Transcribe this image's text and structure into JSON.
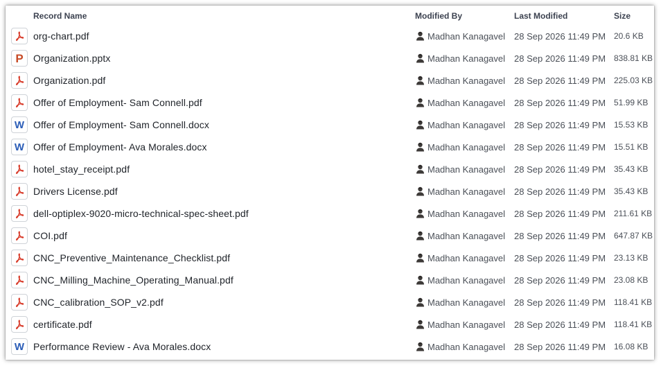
{
  "columns": {
    "record_name": "Record Name",
    "modified_by": "Modified By",
    "last_modified": "Last Modified",
    "size": "Size"
  },
  "colors": {
    "pdf_icon": "#d83b2a",
    "word_icon": "#2b5db7",
    "ppt_icon": "#c74b27"
  },
  "rows": [
    {
      "name": "org-chart.pdf",
      "type": "pdf",
      "modified_by": "Madhan Kanagavel",
      "last_modified": "28 Sep 2026 11:49 PM",
      "size": "20.6 KB"
    },
    {
      "name": "Organization.pptx",
      "type": "pptx",
      "icon_letter": "P",
      "modified_by": "Madhan Kanagavel",
      "last_modified": "28 Sep 2026 11:49 PM",
      "size": "838.81 KB"
    },
    {
      "name": "Organization.pdf",
      "type": "pdf",
      "modified_by": "Madhan Kanagavel",
      "last_modified": "28 Sep 2026 11:49 PM",
      "size": "225.03 KB"
    },
    {
      "name": "Offer of Employment- Sam Connell.pdf",
      "type": "pdf",
      "modified_by": "Madhan Kanagavel",
      "last_modified": "28 Sep 2026 11:49 PM",
      "size": "51.99 KB"
    },
    {
      "name": "Offer of Employment- Sam Connell.docx",
      "type": "docx",
      "icon_letter": "W",
      "modified_by": "Madhan Kanagavel",
      "last_modified": "28 Sep 2026 11:49 PM",
      "size": "15.53 KB"
    },
    {
      "name": "Offer of Employment- Ava Morales.docx",
      "type": "docx",
      "icon_letter": "W",
      "modified_by": "Madhan Kanagavel",
      "last_modified": "28 Sep 2026 11:49 PM",
      "size": "15.51 KB"
    },
    {
      "name": "hotel_stay_receipt.pdf",
      "type": "pdf",
      "modified_by": "Madhan Kanagavel",
      "last_modified": "28 Sep 2026 11:49 PM",
      "size": "35.43 KB"
    },
    {
      "name": "Drivers License.pdf",
      "type": "pdf",
      "modified_by": "Madhan Kanagavel",
      "last_modified": "28 Sep 2026 11:49 PM",
      "size": "35.43 KB"
    },
    {
      "name": "dell-optiplex-9020-micro-technical-spec-sheet.pdf",
      "type": "pdf",
      "modified_by": "Madhan Kanagavel",
      "last_modified": "28 Sep 2026 11:49 PM",
      "size": "211.61 KB"
    },
    {
      "name": "COI.pdf",
      "type": "pdf",
      "modified_by": "Madhan Kanagavel",
      "last_modified": "28 Sep 2026 11:49 PM",
      "size": "647.87 KB"
    },
    {
      "name": "CNC_Preventive_Maintenance_Checklist.pdf",
      "type": "pdf",
      "modified_by": "Madhan Kanagavel",
      "last_modified": "28 Sep 2026 11:49 PM",
      "size": "23.13 KB"
    },
    {
      "name": "CNC_Milling_Machine_Operating_Manual.pdf",
      "type": "pdf",
      "modified_by": "Madhan Kanagavel",
      "last_modified": "28 Sep 2026 11:49 PM",
      "size": "23.08 KB"
    },
    {
      "name": "CNC_calibration_SOP_v2.pdf",
      "type": "pdf",
      "modified_by": "Madhan Kanagavel",
      "last_modified": "28 Sep 2026 11:49 PM",
      "size": "118.41 KB"
    },
    {
      "name": "certificate.pdf",
      "type": "pdf",
      "modified_by": "Madhan Kanagavel",
      "last_modified": "28 Sep 2026 11:49 PM",
      "size": "118.41 KB"
    },
    {
      "name": "Performance Review - Ava Morales.docx",
      "type": "docx",
      "icon_letter": "W",
      "modified_by": "Madhan Kanagavel",
      "last_modified": "28 Sep 2026 11:49 PM",
      "size": "16.08 KB"
    }
  ]
}
